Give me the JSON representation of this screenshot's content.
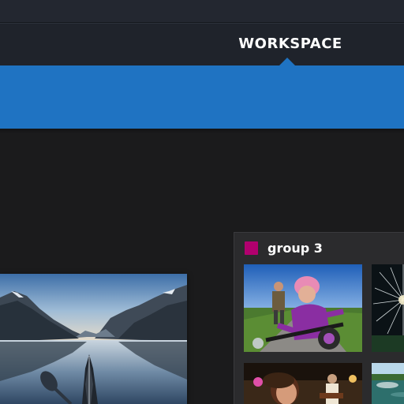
{
  "nav": {
    "active_tab": "WORKSPACE"
  },
  "colors": {
    "top_strip": "#232730",
    "nav_bar": "#1f232b",
    "banner": "#1f73c2",
    "canvas": "#1b1b1c",
    "group_panel": "#2b2b2d",
    "group_swatch": "#b1006e"
  },
  "workspace": {
    "loose_photo": {
      "subject": "fjord-kayak-photo"
    },
    "group": {
      "label": "group 3",
      "swatch_color": "#b1006e",
      "thumbnails": [
        {
          "subject": "girl-on-bike-photo"
        },
        {
          "subject": "fireworks-photo"
        },
        {
          "subject": "concert-crowd-photo"
        },
        {
          "subject": "waterfront-photo"
        }
      ]
    }
  }
}
